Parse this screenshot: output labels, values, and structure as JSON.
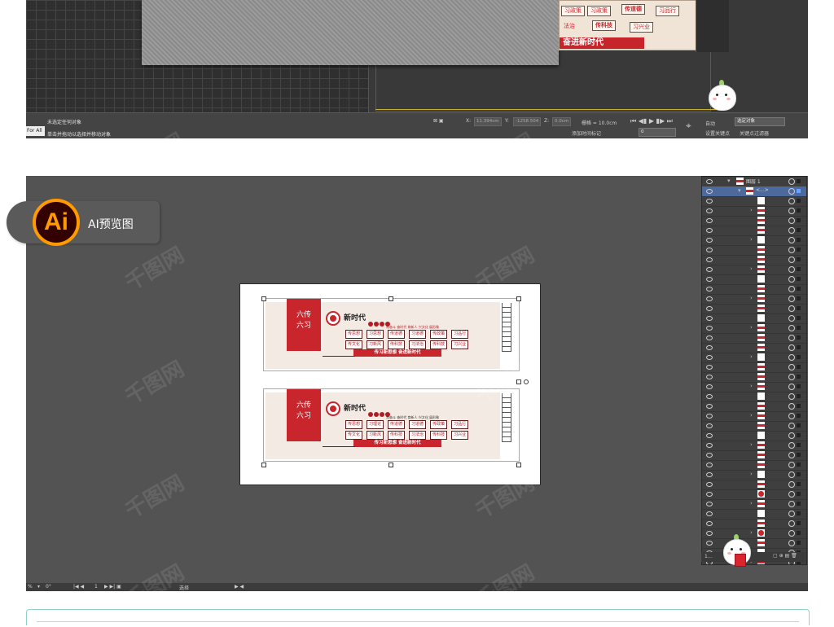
{
  "top_panel": {
    "board_tags": [
      "习政策",
      "传道德",
      "习品行",
      "法治",
      "传科技",
      "习兴业"
    ],
    "board_slogan": "奋进新时代",
    "status_line1": "未选定任何对象",
    "status_line2": "单击并拖动以选择并移动对象",
    "for_all": "For All",
    "x_field": "11.394cm",
    "y_field": "-1258.504",
    "z_field": "0.0cm",
    "grid_label": "栅格 = 10.0cm",
    "add_time_tag": "添加时间标记",
    "auto_label": "自动",
    "selected_obj": "选定对象",
    "set_keys": "设置关键点",
    "key_filter": "关键点过滤器",
    "frame_value": "0"
  },
  "ai_badge": {
    "logo": "Ai",
    "label": "AI预览图"
  },
  "artboard": {
    "boards": [
      {
        "side_text_1": "六传",
        "side_text_2": "六习",
        "title": "新时代",
        "subline": "常奋斗 奋时代 育新人 兴文化 展形象",
        "row1": [
          [
            "传",
            "习"
          ],
          [
            "传",
            "习"
          ],
          [
            "传",
            "习"
          ]
        ],
        "row1_labels": [
          "传思想",
          "习思想",
          "传道德",
          "习道德",
          "传政策",
          "习品行"
        ],
        "row2_labels": [
          "传文化",
          "习新风",
          "传科技",
          "习法治",
          "传科技",
          "习兴业"
        ],
        "slogan": "传习新思想 奋进新时代"
      },
      {
        "side_text_1": "六传",
        "side_text_2": "六习",
        "title": "新时代",
        "subline": "常奋斗 奋时代 育新人 兴文化 展形象",
        "row1_labels": [
          "传思想",
          "习理论",
          "传道德",
          "习道德",
          "传政策",
          "习品行"
        ],
        "row2_labels": [
          "传文化",
          "习新风",
          "传科技",
          "习法治",
          "传科技",
          "习兴业"
        ],
        "slogan": "传习新思想 奋进新时代"
      }
    ]
  },
  "layers_panel": {
    "layer_name": "图层 1",
    "sublayer_name": "<...>"
  },
  "ai_status": {
    "zoom": "%",
    "rotation": "0°",
    "page": "1",
    "tool": "选择"
  },
  "watermark": "千图网",
  "colors": {
    "panel_dark": "#535353",
    "board_red": "#c9252c",
    "ai_orange": "#ff9a00",
    "ai_dark": "#330000",
    "selection_blue": "#4d6a9c",
    "strip_teal": "#8fd3c6"
  }
}
